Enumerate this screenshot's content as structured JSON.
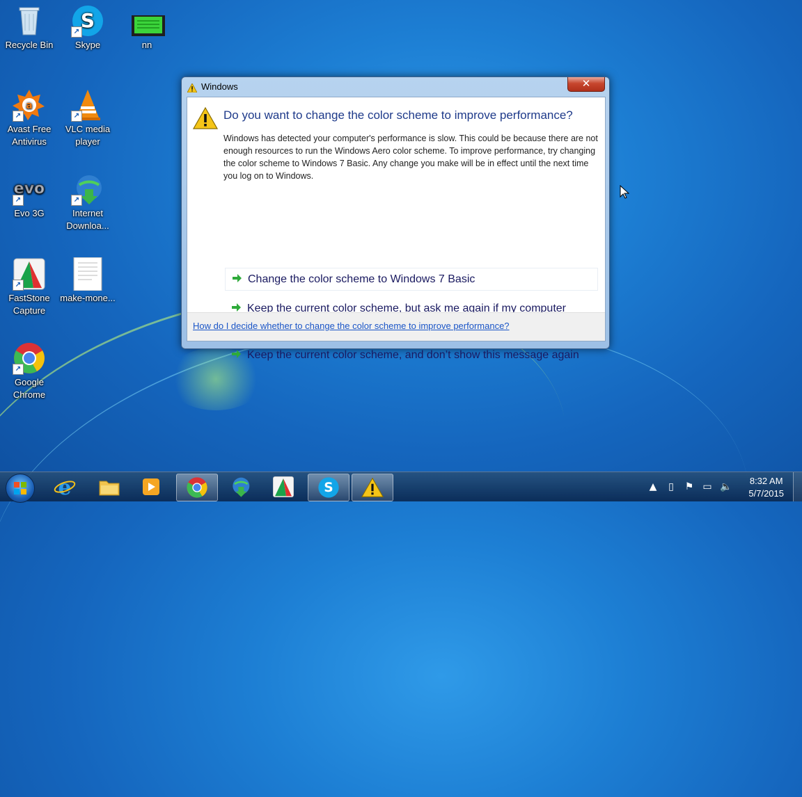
{
  "desktop": {
    "icons": [
      {
        "label_lines": [
          "Recycle Bin"
        ]
      },
      {
        "label_lines": [
          "Skype"
        ]
      },
      {
        "label_lines": [
          "nn"
        ]
      },
      {
        "label_lines": [
          "Avast Free",
          "Antivirus"
        ]
      },
      {
        "label_lines": [
          "VLC media",
          "player"
        ]
      },
      {
        "label_lines": [
          "Evo 3G"
        ]
      },
      {
        "label_lines": [
          "Internet",
          "Downloa..."
        ]
      },
      {
        "label_lines": [
          "FastStone",
          "Capture"
        ]
      },
      {
        "label_lines": [
          "make-mone..."
        ]
      },
      {
        "label_lines": [
          "Google",
          "Chrome"
        ]
      }
    ]
  },
  "dialog": {
    "title": "Windows",
    "close_label": "✕",
    "heading": "Do you want to change the color scheme to improve performance?",
    "description": "Windows has detected your computer's performance is slow. This could be because there are not enough resources to run the Windows Aero color scheme. To improve performance, try changing the color scheme to Windows 7 Basic. Any change you make will be in effect until the next time you log on to Windows.",
    "options": [
      {
        "label": "Change the color scheme to Windows 7 Basic"
      },
      {
        "label": "Keep the current color scheme, but ask me again if my computer continues to perform slowly"
      },
      {
        "label": "Keep the current color scheme, and don’t show this message again"
      }
    ],
    "help_link": "How do I decide whether to change the color scheme to improve performance?"
  },
  "taskbar": {
    "items": [
      "internet-explorer-icon",
      "file-explorer-icon",
      "media-player-icon",
      "chrome-icon",
      "internet-download-manager-icon",
      "faststone-capture-icon",
      "skype-icon",
      "warning-icon"
    ],
    "clock": {
      "time": "8:32 AM",
      "date": "5/7/2015"
    }
  },
  "colors": {
    "heading": "#1e3a8a",
    "link": "#1a55c7",
    "option_arrow": "#2eaa3a"
  }
}
